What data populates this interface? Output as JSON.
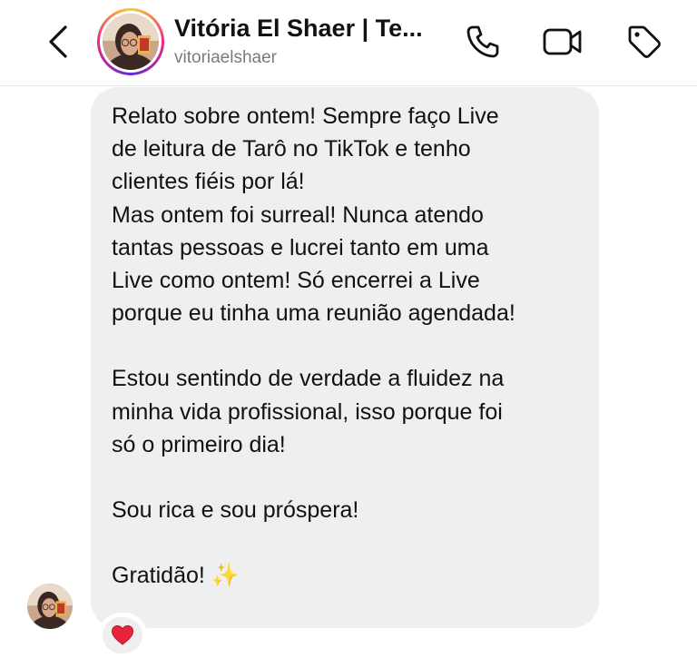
{
  "header": {
    "display_name": "Vitória El Shaer | Te...",
    "username": "vitoriaelshaer",
    "icons": {
      "back": "chevron-left-icon",
      "call": "phone-icon",
      "video": "video-camera-icon",
      "tag": "tag-icon"
    }
  },
  "message": {
    "paragraphs": [
      "Relato sobre ontem! Sempre faço Live\nde leitura de Tarô no TikTok e tenho\nclientes fiéis por lá!",
      "Mas ontem foi surreal! Nunca atendo\ntantas pessoas e lucrei tanto em uma\nLive como ontem! Só encerrei a Live\nporque eu tinha uma reunião agendada!",
      "Estou sentindo de verdade a fluidez na\nminha vida profissional, isso porque foi\nsó o primeiro dia!",
      "Sou rica e sou próspera!",
      "Gratidão! ✨"
    ],
    "reaction": "❤️"
  },
  "colors": {
    "bubble": "#efefef",
    "username": "#7a7a7a",
    "divider": "#e6e6e6"
  }
}
